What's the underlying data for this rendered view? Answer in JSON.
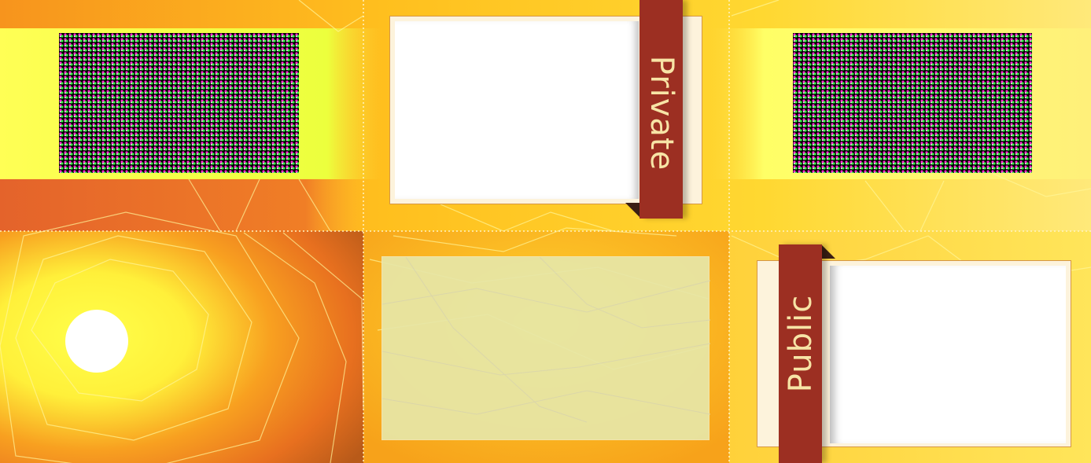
{
  "colors": {
    "background_main": "#f7b21c",
    "background_light": "#ffe04a",
    "ribbon": "#9c2f22",
    "ribbon_text": "#f7e4a6",
    "panel_fill": "#e7e7a8"
  },
  "tiles": {
    "top_left": {
      "thumbnail": "halftone-thumbnail-icon"
    },
    "top_right": {
      "thumbnail": "halftone-thumbnail-icon"
    },
    "private_card": {
      "ribbon_label": "Private"
    },
    "public_card": {
      "ribbon_label": "Public"
    },
    "sun_tile": {
      "icon": "sun-icon"
    },
    "empty_panel": {}
  }
}
